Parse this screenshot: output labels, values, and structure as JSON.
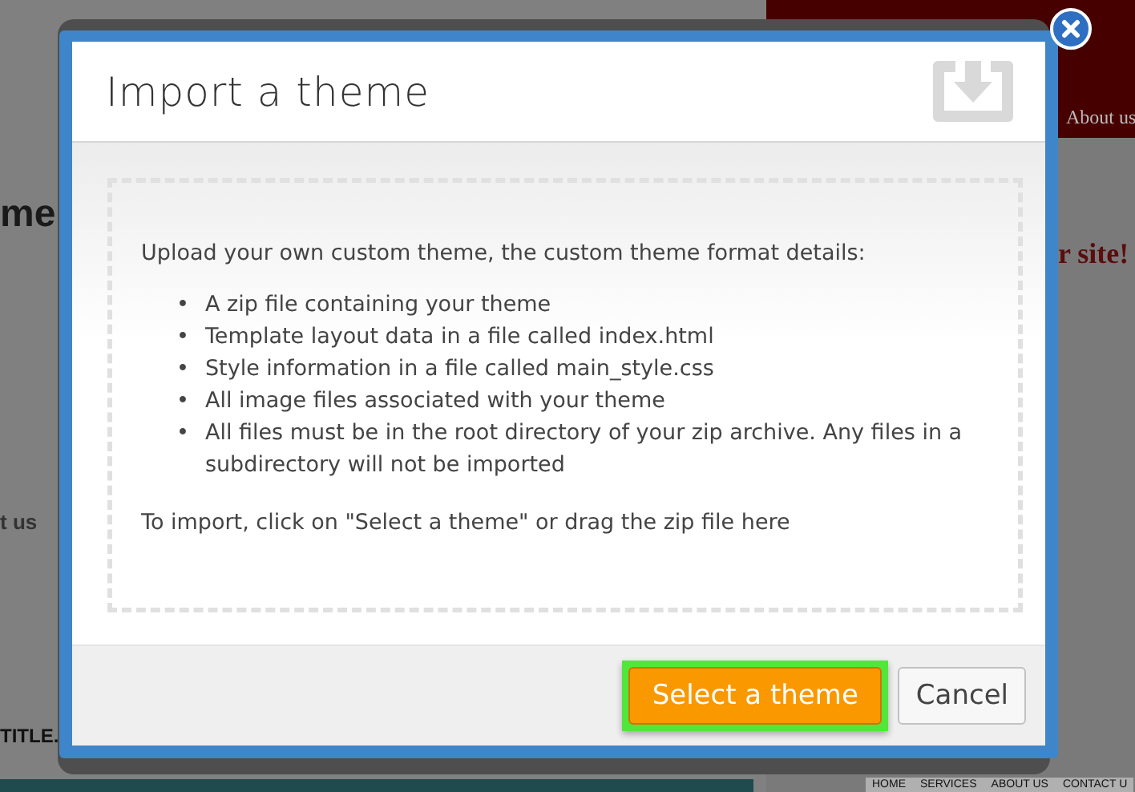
{
  "background_page": {
    "heading_fragment": "me",
    "tagline_fragment": "r site!",
    "nav_fragment": "About us",
    "section_fragment": "t us",
    "title_fragment": "TITLE.",
    "footer_nav": [
      "HOME",
      "SERVICES",
      "ABOUT US",
      "CONTACT U"
    ]
  },
  "dialog": {
    "title": "Import a theme",
    "intro": "Upload your own custom theme, the custom theme format details:",
    "bullet": "•",
    "requirements": [
      "A zip file containing your theme",
      "Template layout data in a file called index.html",
      "Style information in a file called main_style.css",
      "All image files associated with your theme",
      "All files must be in the root directory of your zip archive. Any files in a subdirectory will not be imported"
    ],
    "instruction": "To import, click on \"Select a theme\" or drag the zip file here",
    "buttons": [
      {
        "label": "Select a theme",
        "kind": "primary",
        "highlighted": true
      },
      {
        "label": "Cancel",
        "kind": "secondary",
        "highlighted": false
      }
    ]
  }
}
